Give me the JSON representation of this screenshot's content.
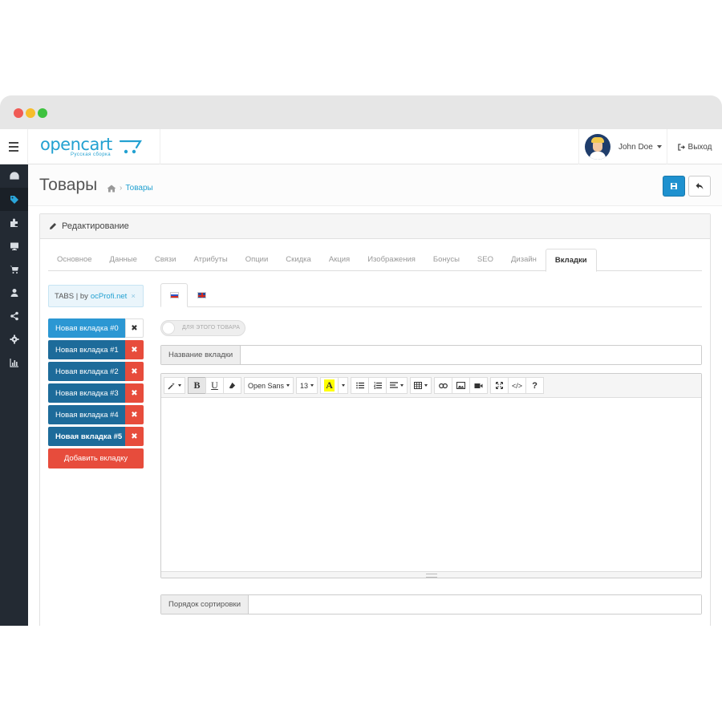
{
  "header": {
    "logo_text": "opencart",
    "logo_sub": "Русская сборка",
    "user_name": "John Doe",
    "logout_label": "Выход"
  },
  "sidebar": {
    "items": [
      {
        "icon": "dashboard-icon"
      },
      {
        "icon": "tag-icon",
        "active": true
      },
      {
        "icon": "puzzle-icon"
      },
      {
        "icon": "desktop-icon"
      },
      {
        "icon": "cart-icon"
      },
      {
        "icon": "user-icon"
      },
      {
        "icon": "share-icon"
      },
      {
        "icon": "gear-icon"
      },
      {
        "icon": "bar-chart-icon"
      }
    ]
  },
  "page": {
    "title": "Товары",
    "breadcrumb": "Товары"
  },
  "panel": {
    "heading": "Редактирование"
  },
  "tabs": [
    "Основное",
    "Данные",
    "Связи",
    "Атрибуты",
    "Опции",
    "Скидка",
    "Акция",
    "Изображения",
    "Бонусы",
    "SEO",
    "Дизайн",
    "Вкладки"
  ],
  "active_tab": "Вкладки",
  "module_badge": {
    "prefix": "TABS | by",
    "link": "ocProfi.net",
    "close": "×"
  },
  "custom_tabs": [
    {
      "label": "Новая вкладка #0"
    },
    {
      "label": "Новая вкладка #1"
    },
    {
      "label": "Новая вкладка #2"
    },
    {
      "label": "Новая вкладка #3"
    },
    {
      "label": "Новая вкладка #4"
    },
    {
      "label": "Новая вкладка #5"
    }
  ],
  "add_tab_label": "Добавить вкладку",
  "toggle_label": "ДЛЯ ЭТОГО ТОВАРА",
  "tab_name_label": "Название вкладки",
  "editor": {
    "font_name": "Open Sans",
    "font_size": "13",
    "highlight_letter": "A",
    "bold": "B",
    "underline": "U",
    "code": "</>",
    "help": "?"
  },
  "sort_label": "Порядок сортировки"
}
